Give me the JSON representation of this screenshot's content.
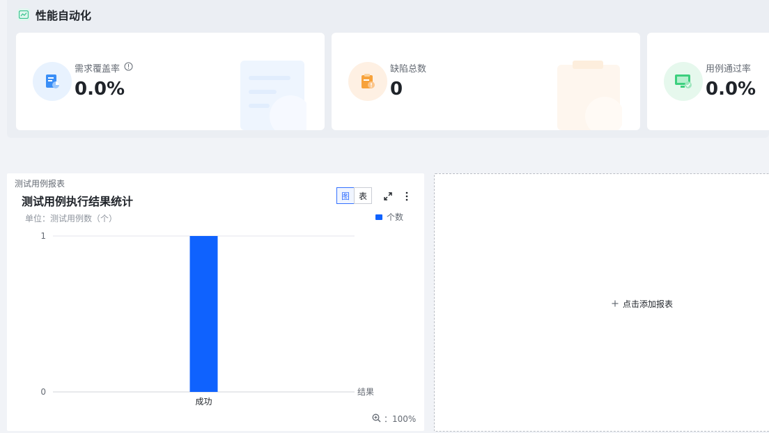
{
  "section": {
    "title": "性能自动化"
  },
  "cards": [
    {
      "label": "需求覆盖率",
      "value": "0.0%",
      "icon": "requirement-coverage-icon",
      "color": "#3a8ef6"
    },
    {
      "label": "缺陷总数",
      "value": "0",
      "icon": "defect-clipboard-icon",
      "color": "#f7a23b"
    },
    {
      "label": "用例通过率",
      "value": "0.0%",
      "icon": "monitor-check-icon",
      "color": "#3ccf7e"
    }
  ],
  "report": {
    "caption": "测试用例报表",
    "title": "测试用例执行结果统计",
    "toggle": {
      "chart": "图",
      "table": "表"
    },
    "unit": "单位：测试用例数（个）",
    "zoom": "：100%"
  },
  "chart_data": {
    "type": "bar",
    "categories": [
      "成功"
    ],
    "series": [
      {
        "name": "个数",
        "values": [
          1
        ],
        "color": "#0f62fe"
      }
    ],
    "xlabel": "结果",
    "ylabel": "",
    "ylim": [
      0,
      1
    ],
    "y_ticks": [
      "0",
      "1"
    ],
    "grid": true,
    "legend": "top-right"
  },
  "add_report": {
    "label": "点击添加报表"
  }
}
